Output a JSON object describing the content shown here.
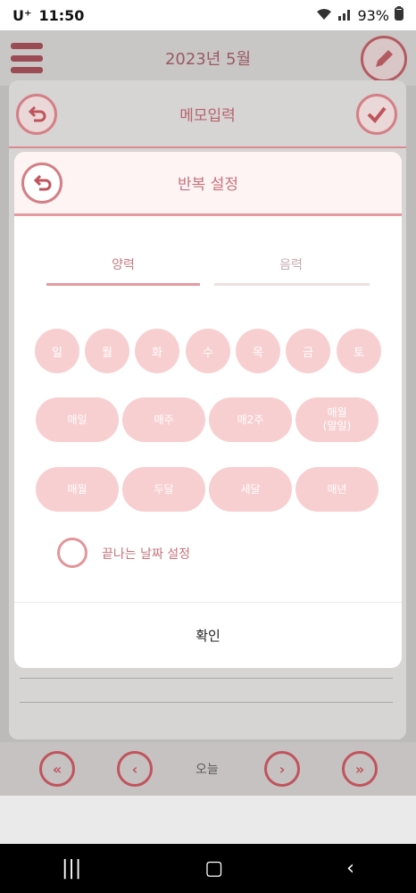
{
  "status_bar": {
    "carrier": "U⁺",
    "time": "11:50",
    "battery": "93%"
  },
  "app_header": {
    "title": "2023년 5월"
  },
  "memo_dialog": {
    "title": "메모입력"
  },
  "repeat_dialog": {
    "title": "반복 설정",
    "tabs": [
      {
        "label": "양력"
      },
      {
        "label": "음력"
      }
    ],
    "weekdays": [
      "일",
      "월",
      "화",
      "수",
      "목",
      "금",
      "토"
    ],
    "row1": [
      "매일",
      "매주",
      "매2주",
      "매월\n(말일)"
    ],
    "row2": [
      "매월",
      "두달",
      "세달",
      "매년"
    ],
    "end_date_label": "끝나는 날짜 설정",
    "confirm_label": "확인"
  },
  "bottom_nav": {
    "today_label": "오늘"
  },
  "colors": {
    "accent": "#c0545c",
    "pill": "#f8cfd1",
    "header_bg": "#fff4f4"
  },
  "icons": [
    "menu-icon",
    "edit-icon",
    "back-icon",
    "check-icon",
    "double-left-icon",
    "left-icon",
    "right-icon",
    "double-right-icon",
    "recents-icon",
    "home-icon",
    "back-nav-icon",
    "wifi-icon",
    "signal-icon",
    "battery-icon"
  ]
}
